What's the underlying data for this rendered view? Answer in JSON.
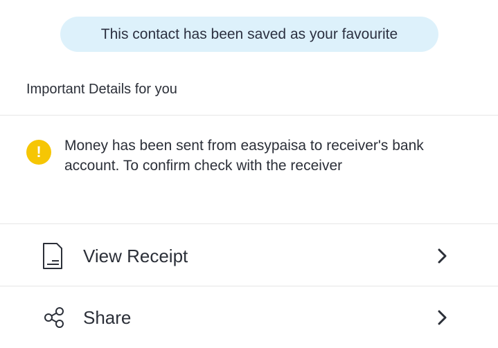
{
  "toast": {
    "message": "This contact has been saved as your favourite"
  },
  "important_details": {
    "title": "Important Details for you",
    "notice": {
      "icon": "warning-icon",
      "icon_glyph": "!",
      "icon_color": "#f6c604",
      "text": "Money has been sent from easypaisa to receiver's bank account. To confirm check with the receiver"
    }
  },
  "actions": [
    {
      "icon": "receipt-icon",
      "label": "View Receipt",
      "chevron": "chevron-right-icon"
    },
    {
      "icon": "share-icon",
      "label": "Share",
      "chevron": "chevron-right-icon"
    }
  ],
  "colors": {
    "toast_bg": "#ddf1fb",
    "text": "#2b2f38",
    "divider": "#e6e6e6"
  }
}
